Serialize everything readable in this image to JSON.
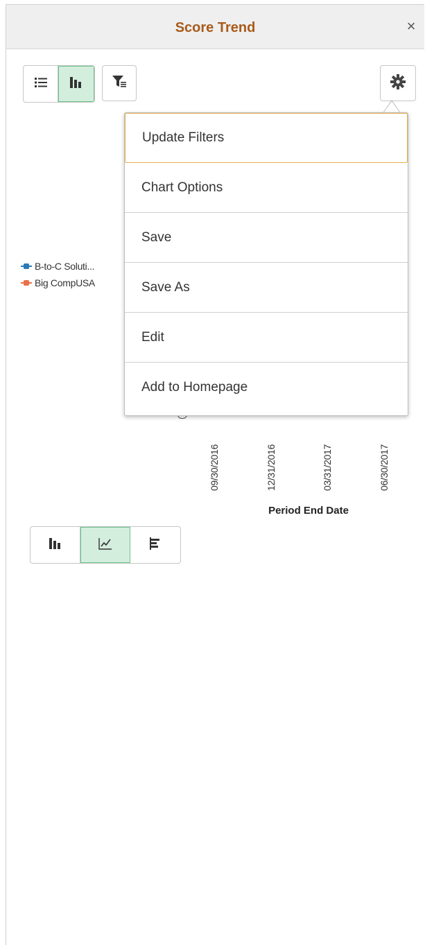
{
  "header": {
    "title": "Score Trend",
    "close_label": "×"
  },
  "toolbar": {
    "view_toggle": [
      "list-view-icon",
      "chart-view-icon"
    ],
    "active_view": "chart-view-icon",
    "filter_icon": "filter-icon",
    "settings_icon": "gear-icon"
  },
  "actions_menu": {
    "items": [
      {
        "label": "Update Filters"
      },
      {
        "label": "Chart Options"
      },
      {
        "label": "Save"
      },
      {
        "label": "Save As"
      },
      {
        "label": "Edit"
      },
      {
        "label": "Add to Homepage"
      }
    ],
    "focused_item": "Update Filters"
  },
  "chart": {
    "legend": [
      {
        "label": "B-to-C Soluti...",
        "color": "#2a7ab8"
      },
      {
        "label": "Big CompUSA",
        "color": "#e8704a"
      }
    ],
    "x_tick_labels": [
      "09/30/2016",
      "12/31/2016",
      "03/31/2017",
      "06/30/2017"
    ],
    "x_axis_title": "Period End Date"
  },
  "chart_type_toggle": {
    "options": [
      "bar-chart-icon",
      "line-chart-icon",
      "horizontal-bar-chart-icon"
    ],
    "active": "line-chart-icon"
  },
  "colors": {
    "accent_title": "#a85b1a",
    "active_toggle_bg": "#d4eede",
    "menu_focus_border": "#e8b14a"
  }
}
